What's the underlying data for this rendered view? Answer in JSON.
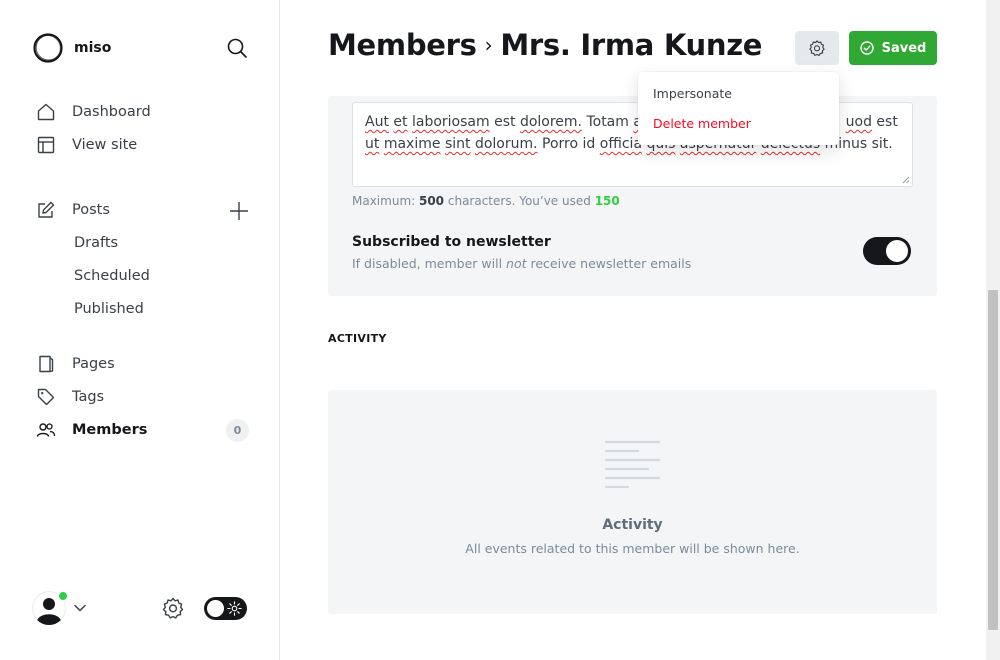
{
  "brand": {
    "name": "miso"
  },
  "nav": {
    "dashboard": "Dashboard",
    "view_site": "View site",
    "posts": "Posts",
    "drafts": "Drafts",
    "scheduled": "Scheduled",
    "published": "Published",
    "pages": "Pages",
    "tags": "Tags",
    "members": "Members",
    "members_count": "0"
  },
  "header": {
    "breadcrumb_parent": "Members",
    "separator": "›",
    "member_name": "Mrs. Irma Kunze",
    "saved_label": "Saved"
  },
  "dropdown": {
    "impersonate": "Impersonate",
    "delete": "Delete member"
  },
  "note": {
    "w1": "Aut",
    "w2": "et",
    "w3": "laboriosam",
    "w4": "est",
    "w5": "dolorem.",
    "w6": "Totam",
    "w7": "ac",
    "w8": "uod",
    "w9": "est",
    "line2_a": "ut",
    "line2_b": "maxime",
    "line2_c": "sint",
    "line2_d": "dolorum.",
    "line2_e": "Porro",
    "line2_f": "id",
    "line2_g": "officia",
    "line2_h": "quis",
    "line2_i": "aspernatur",
    "line2_j": "delectus",
    "line2_k": "minus sit."
  },
  "char_hint": {
    "prefix": "Maximum: ",
    "max": "500",
    "middle": " characters. You’ve used ",
    "used": "150"
  },
  "newsletter": {
    "title": "Subscribed to newsletter",
    "desc_a": "If disabled, member will ",
    "desc_em": "not",
    "desc_b": " receive newsletter emails",
    "enabled": true
  },
  "activity": {
    "heading": "ACTIVITY",
    "empty_title": "Activity",
    "empty_desc": "All events related to this member will be shown here."
  },
  "colors": {
    "accent_green": "#30a934",
    "badge_green": "#30cf43",
    "danger_red": "#f50b23",
    "panel_bg": "#f4f5f6"
  }
}
